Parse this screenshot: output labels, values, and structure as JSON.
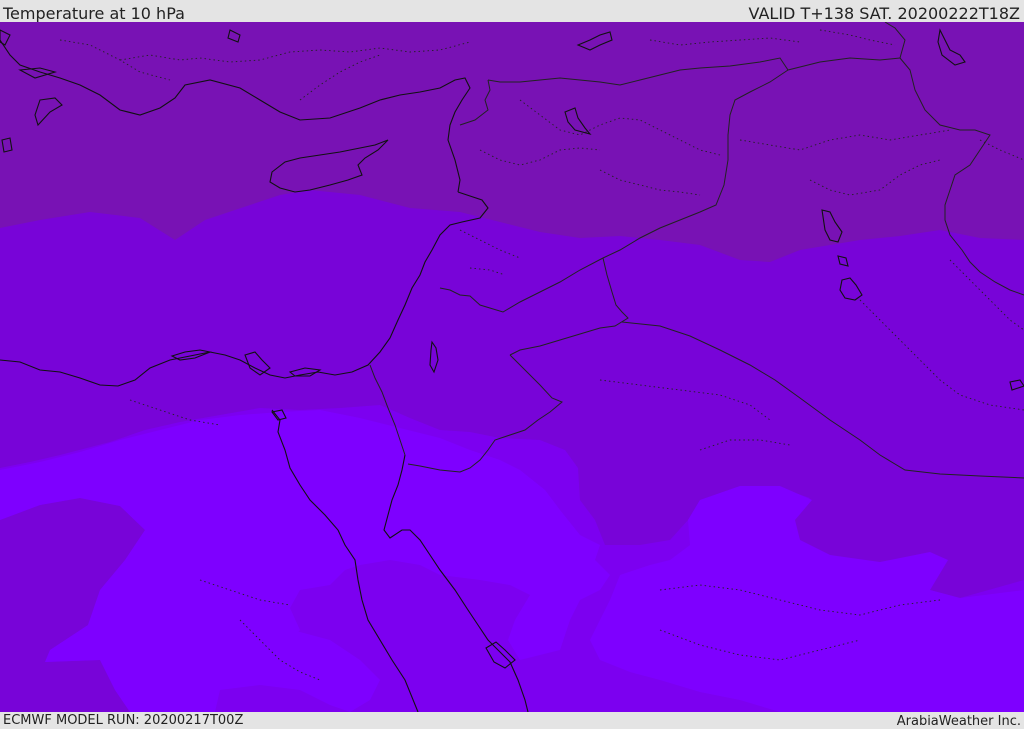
{
  "header": {
    "title": "Temperature at 10 hPa",
    "valid": "VALID T+138 SAT. 20200222T18Z"
  },
  "footer": {
    "model_run": "ECMWF MODEL RUN: 20200217T00Z",
    "credit": "ArabiaWeather Inc."
  },
  "map": {
    "colors": {
      "band_coldest": "#7812b4",
      "band_cold": "#7804d8",
      "band_mid": "#7c00f0",
      "band_warm": "#7e00ff",
      "coastline": "#111111",
      "border": "#222222"
    }
  }
}
